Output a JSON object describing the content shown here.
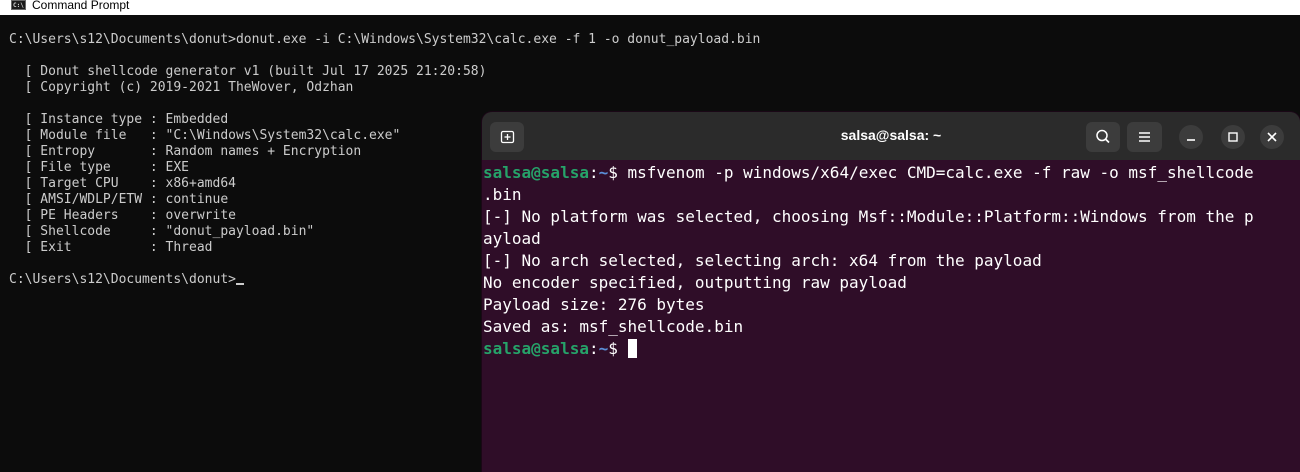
{
  "cmd": {
    "title": "Command Prompt",
    "icon_text": "C:\\",
    "lines": [
      "C:\\Users\\s12\\Documents\\donut>donut.exe -i C:\\Windows\\System32\\calc.exe -f 1 -o donut_payload.bin",
      "",
      "  [ Donut shellcode generator v1 (built Jul 17 2025 21:20:58)",
      "  [ Copyright (c) 2019-2021 TheWover, Odzhan",
      "",
      "  [ Instance type : Embedded",
      "  [ Module file   : \"C:\\Windows\\System32\\calc.exe\"",
      "  [ Entropy       : Random names + Encryption",
      "  [ File type     : EXE",
      "  [ Target CPU    : x86+amd64",
      "  [ AMSI/WDLP/ETW : continue",
      "  [ PE Headers    : overwrite",
      "  [ Shellcode     : \"donut_payload.bin\"",
      "  [ Exit          : Thread",
      ""
    ],
    "prompt": "C:\\Users\\s12\\Documents\\donut>"
  },
  "terminal": {
    "title": "salsa@salsa: ~",
    "prompt_user": "salsa@salsa",
    "prompt_colon": ":",
    "prompt_path": "~",
    "prompt_dollar": "$ ",
    "command": "msfvenom -p windows/x64/exec CMD=calc.exe -f raw -o msf_shellcode",
    "command_wrap": ".bin",
    "output": [
      "[-] No platform was selected, choosing Msf::Module::Platform::Windows from the p",
      "ayload",
      "[-] No arch selected, selecting arch: x64 from the payload",
      "No encoder specified, outputting raw payload",
      "Payload size: 276 bytes",
      "Saved as: msf_shellcode.bin"
    ]
  },
  "colors": {
    "cmd_bg": "#0c0c0c",
    "cmd_text": "#cccccc",
    "term_bg": "#2f0d28",
    "term_header": "#2b2b2b",
    "prompt_user": "#26a269",
    "prompt_path": "#5b8fd8"
  },
  "icons": [
    "cmd-app-icon",
    "new-tab-icon",
    "search-icon",
    "hamburger-menu-icon",
    "minimize-icon",
    "maximize-icon",
    "close-icon"
  ]
}
